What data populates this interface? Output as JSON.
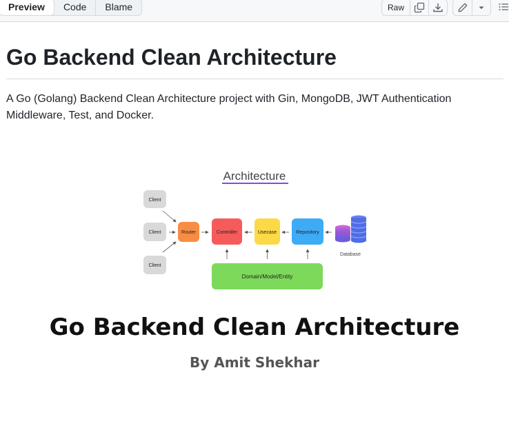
{
  "toolbar": {
    "tabs": [
      "Preview",
      "Code",
      "Blame"
    ],
    "raw_label": "Raw"
  },
  "readme": {
    "title": "Go Backend Clean Architecture",
    "description": "A Go (Golang) Backend Clean Architecture project with Gin, MongoDB, JWT Authentication Middleware, Test, and Docker."
  },
  "banner": {
    "heading": "Architecture",
    "clients": [
      "Client",
      "Client",
      "Client"
    ],
    "router": "Router",
    "controller": "Controller",
    "usecase": "Usecase",
    "repository": "Repository",
    "database": "Database",
    "domain": "Domain/Model/Entity",
    "big_title": "Go Backend Clean Architecture",
    "author": "By Amit Shekhar",
    "colors": {
      "client": "#d9d9d9",
      "router": "#f98c44",
      "controller": "#f65b5c",
      "usecase": "#fcd947",
      "repository": "#3eabf7",
      "domain": "#7dd95a",
      "underline": "#7b4fd8"
    }
  }
}
